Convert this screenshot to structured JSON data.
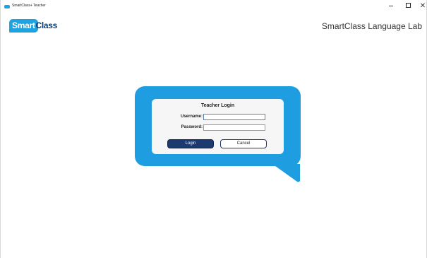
{
  "window": {
    "title": "SmartClass+ Teacher",
    "minimize_label": "",
    "maximize_label": "",
    "close_label": "✕"
  },
  "header": {
    "logo_smart": "Smart",
    "logo_class": "Class",
    "app_name": "SmartClass Language Lab"
  },
  "login": {
    "title": "Teacher Login",
    "username_label": "Username:",
    "username_value": "",
    "password_label": "Password:",
    "password_value": "",
    "login_button": "Login",
    "cancel_button": "Cancel"
  },
  "colors": {
    "bubble": "#1e9ee0",
    "logo_blue": "#1ea3e0",
    "logo_dark": "#0e3a6e",
    "login_button": "#1c3a70"
  },
  "icons": {
    "app_icon": "smartclass-app-icon",
    "minimize": "minimize-icon",
    "maximize": "maximize-icon",
    "close": "close-icon"
  }
}
